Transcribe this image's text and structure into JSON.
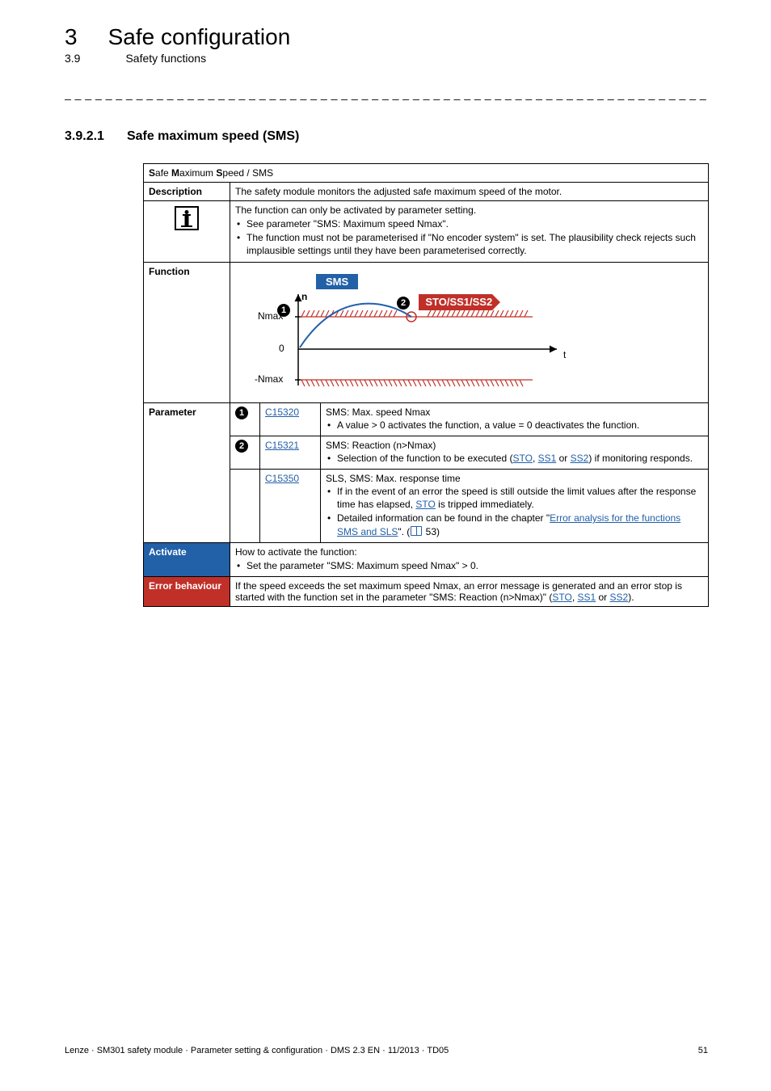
{
  "header": {
    "chapter_num": "3",
    "chapter_title": "Safe configuration",
    "section_num": "3.9",
    "section_title": "Safety functions"
  },
  "separator": "_ _ _ _ _ _ _ _ _ _ _ _ _ _ _ _ _ _ _ _ _ _ _ _ _ _ _ _ _ _ _ _ _ _ _ _ _ _ _ _ _ _ _ _ _ _ _ _ _ _ _ _ _ _ _ _ _ _ _ _ _ _ _ _",
  "subsection": {
    "num": "3.9.2.1",
    "title": "Safe maximum speed (SMS)"
  },
  "table": {
    "title_pre": "S",
    "title_mid1": "afe ",
    "title_b2": "M",
    "title_mid2": "aximum ",
    "title_b3": "S",
    "title_mid3": "peed / SMS",
    "rows": {
      "description": {
        "label": "Description",
        "text": "The safety module monitors the adjusted safe maximum speed of the motor."
      },
      "info": {
        "lead": "The function can only be activated by parameter setting.",
        "b1": "See parameter \"SMS: Maximum speed Nmax\".",
        "b2": "The function must not be parameterised if \"No encoder system\" is set. The plausibility check rejects such implausible settings until they have been parameterised correctly."
      },
      "function_label": "Function",
      "graph": {
        "sms": "SMS",
        "sto": "STO/SS1/SS2",
        "n": "n",
        "nmax": "Nmax",
        "zero": "0",
        "nnmax": "-Nmax",
        "t": "t",
        "m1": "1",
        "m2": "2"
      },
      "parameter_label": "Parameter",
      "params": [
        {
          "marker": "1",
          "code": "C15320",
          "title": "SMS: Max. speed Nmax",
          "b1": "A value > 0 activates the function, a value = 0 deactivates the function."
        },
        {
          "marker": "2",
          "code": "C15321",
          "title": "SMS: Reaction (n>Nmax)",
          "b1_pre": "Selection of the function to be executed (",
          "b1_l1": "STO",
          "b1_mid1": ", ",
          "b1_l2": "SS1",
          "b1_mid2": " or ",
          "b1_l3": "SS2",
          "b1_post": ") if monitoring responds."
        },
        {
          "marker": "",
          "code": "C15350",
          "title": "SLS, SMS: Max. response time",
          "b1_pre": "If in the event of an error the speed is still outside the limit values after the response time has elapsed, ",
          "b1_l1": "STO",
          "b1_post": " is tripped immediately.",
          "b2_pre": "Detailed information can be found in the chapter \"",
          "b2_l1": "Error analysis for the functions SMS and SLS",
          "b2_post": "\". (",
          "b2_page": " 53)"
        }
      ],
      "activate": {
        "label": "Activate",
        "lead": "How to activate the function:",
        "b1": "Set the parameter \"SMS: Maximum speed Nmax\" > 0."
      },
      "error": {
        "label": "Error behaviour",
        "pre": "If the speed exceeds the set maximum speed Nmax, an error message is generated and an error stop is started with the function set in the parameter \"SMS: Reaction (n>Nmax)\" (",
        "l1": "STO",
        "m1": ", ",
        "l2": "SS1",
        "m2": " or ",
        "l3": "SS2",
        "post": ")."
      }
    }
  },
  "footer": {
    "left": "Lenze · SM301 safety module · Parameter setting & configuration · DMS 2.3 EN · 11/2013 · TD05",
    "right": "51"
  }
}
